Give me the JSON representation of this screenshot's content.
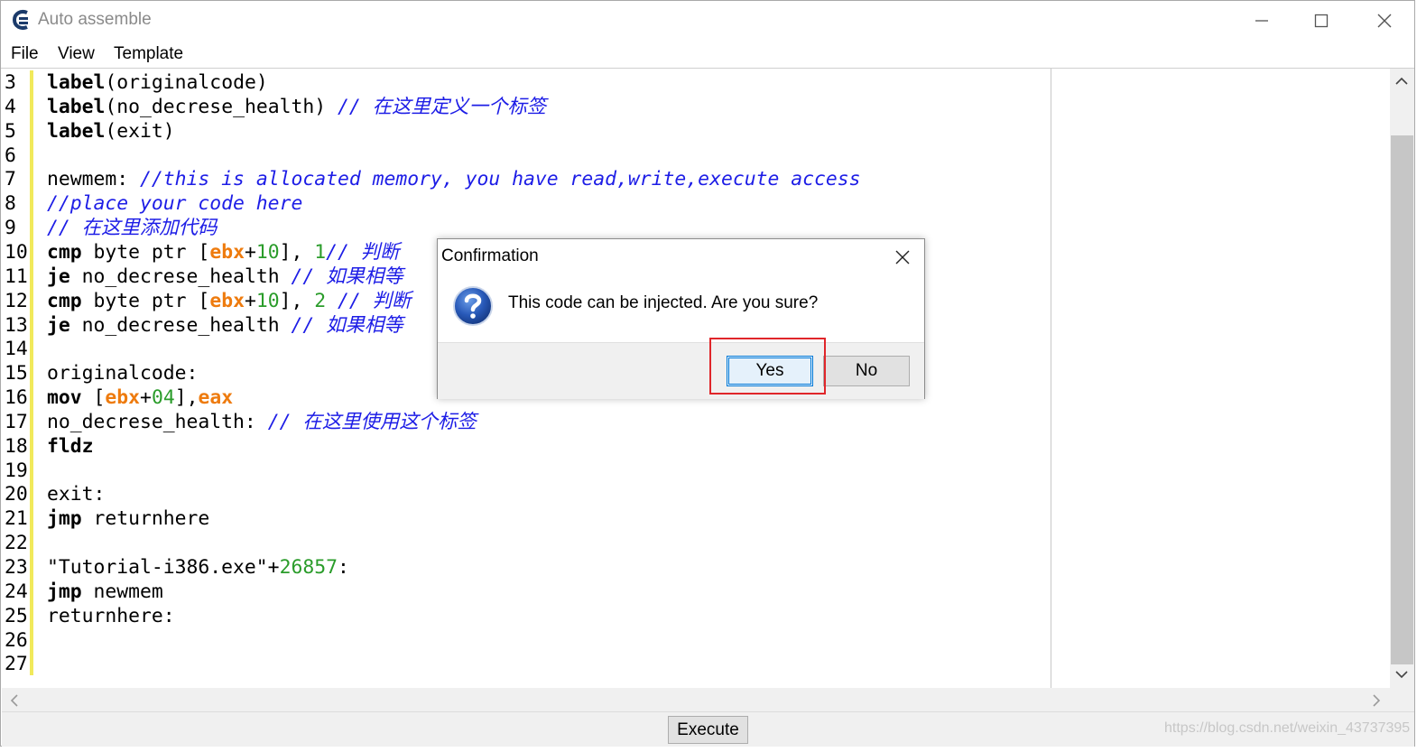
{
  "window": {
    "title": "Auto assemble",
    "menu": [
      "File",
      "View",
      "Template"
    ]
  },
  "editor": {
    "lines": [
      {
        "n": "3",
        "tokens": [
          {
            "t": "label",
            "c": "kw"
          },
          {
            "t": "(originalcode)",
            "c": ""
          }
        ]
      },
      {
        "n": "4",
        "tokens": [
          {
            "t": "label",
            "c": "kw"
          },
          {
            "t": "(no_decrese_health) ",
            "c": ""
          },
          {
            "t": "// 在这里定义一个标签",
            "c": "cm"
          }
        ]
      },
      {
        "n": "5",
        "tokens": [
          {
            "t": "label",
            "c": "kw"
          },
          {
            "t": "(exit)",
            "c": ""
          }
        ]
      },
      {
        "n": "6",
        "tokens": []
      },
      {
        "n": "7",
        "tokens": [
          {
            "t": "newmem: ",
            "c": ""
          },
          {
            "t": "//this is allocated memory, you have read,write,execute access",
            "c": "cm"
          }
        ]
      },
      {
        "n": "8",
        "tokens": [
          {
            "t": "//place your code here",
            "c": "cm"
          }
        ]
      },
      {
        "n": "9",
        "tokens": [
          {
            "t": "// 在这里添加代码",
            "c": "cm"
          }
        ]
      },
      {
        "n": "10",
        "tokens": [
          {
            "t": "cmp",
            "c": "kw"
          },
          {
            "t": " byte ptr [",
            "c": ""
          },
          {
            "t": "ebx",
            "c": "rg"
          },
          {
            "t": "+",
            "c": ""
          },
          {
            "t": "10",
            "c": "nm"
          },
          {
            "t": "], ",
            "c": ""
          },
          {
            "t": "1",
            "c": "nm"
          },
          {
            "t": "// 判断",
            "c": "cm"
          }
        ]
      },
      {
        "n": "11",
        "tokens": [
          {
            "t": "je",
            "c": "kw"
          },
          {
            "t": " no_decrese_health ",
            "c": ""
          },
          {
            "t": "// 如果相等",
            "c": "cm"
          }
        ]
      },
      {
        "n": "12",
        "tokens": [
          {
            "t": "cmp",
            "c": "kw"
          },
          {
            "t": " byte ptr [",
            "c": ""
          },
          {
            "t": "ebx",
            "c": "rg"
          },
          {
            "t": "+",
            "c": ""
          },
          {
            "t": "10",
            "c": "nm"
          },
          {
            "t": "], ",
            "c": ""
          },
          {
            "t": "2",
            "c": "nm"
          },
          {
            "t": " // 判断",
            "c": "cm"
          }
        ]
      },
      {
        "n": "13",
        "tokens": [
          {
            "t": "je",
            "c": "kw"
          },
          {
            "t": " no_decrese_health ",
            "c": ""
          },
          {
            "t": "// 如果相等",
            "c": "cm"
          }
        ]
      },
      {
        "n": "14",
        "tokens": []
      },
      {
        "n": "15",
        "tokens": [
          {
            "t": "originalcode:",
            "c": ""
          }
        ]
      },
      {
        "n": "16",
        "tokens": [
          {
            "t": "mov",
            "c": "kw"
          },
          {
            "t": " [",
            "c": ""
          },
          {
            "t": "ebx",
            "c": "rg"
          },
          {
            "t": "+",
            "c": ""
          },
          {
            "t": "04",
            "c": "nm"
          },
          {
            "t": "],",
            "c": ""
          },
          {
            "t": "eax",
            "c": "rg"
          }
        ]
      },
      {
        "n": "17",
        "tokens": [
          {
            "t": "no_decrese_health: ",
            "c": ""
          },
          {
            "t": "// 在这里使用这个标签",
            "c": "cm"
          }
        ]
      },
      {
        "n": "18",
        "tokens": [
          {
            "t": "fldz",
            "c": "kw"
          }
        ]
      },
      {
        "n": "19",
        "tokens": []
      },
      {
        "n": "20",
        "tokens": [
          {
            "t": "exit:",
            "c": ""
          }
        ]
      },
      {
        "n": "21",
        "tokens": [
          {
            "t": "jmp",
            "c": "kw"
          },
          {
            "t": " returnhere",
            "c": ""
          }
        ]
      },
      {
        "n": "22",
        "tokens": []
      },
      {
        "n": "23",
        "tokens": [
          {
            "t": "\"Tutorial-i386.exe\"+",
            "c": ""
          },
          {
            "t": "26857",
            "c": "nm"
          },
          {
            "t": ":",
            "c": ""
          }
        ]
      },
      {
        "n": "24",
        "tokens": [
          {
            "t": "jmp",
            "c": "kw"
          },
          {
            "t": " newmem",
            "c": ""
          }
        ]
      },
      {
        "n": "25",
        "tokens": [
          {
            "t": "returnhere:",
            "c": ""
          }
        ]
      },
      {
        "n": "26",
        "tokens": []
      },
      {
        "n": "27",
        "tokens": []
      }
    ]
  },
  "footer": {
    "execute_label": "Execute",
    "watermark": "https://blog.csdn.net/weixin_43737395"
  },
  "dialog": {
    "title": "Confirmation",
    "message": "This code can be injected. Are you sure?",
    "yes_label": "Yes",
    "no_label": "No",
    "icon": "question-icon"
  },
  "colors": {
    "comment": "#1d1de6",
    "register": "#ee7b0e",
    "number": "#2a9c2a",
    "gutter_marker": "#f1e95b",
    "highlight_frame": "#e0262a",
    "focus_blue": "#0078d7"
  }
}
